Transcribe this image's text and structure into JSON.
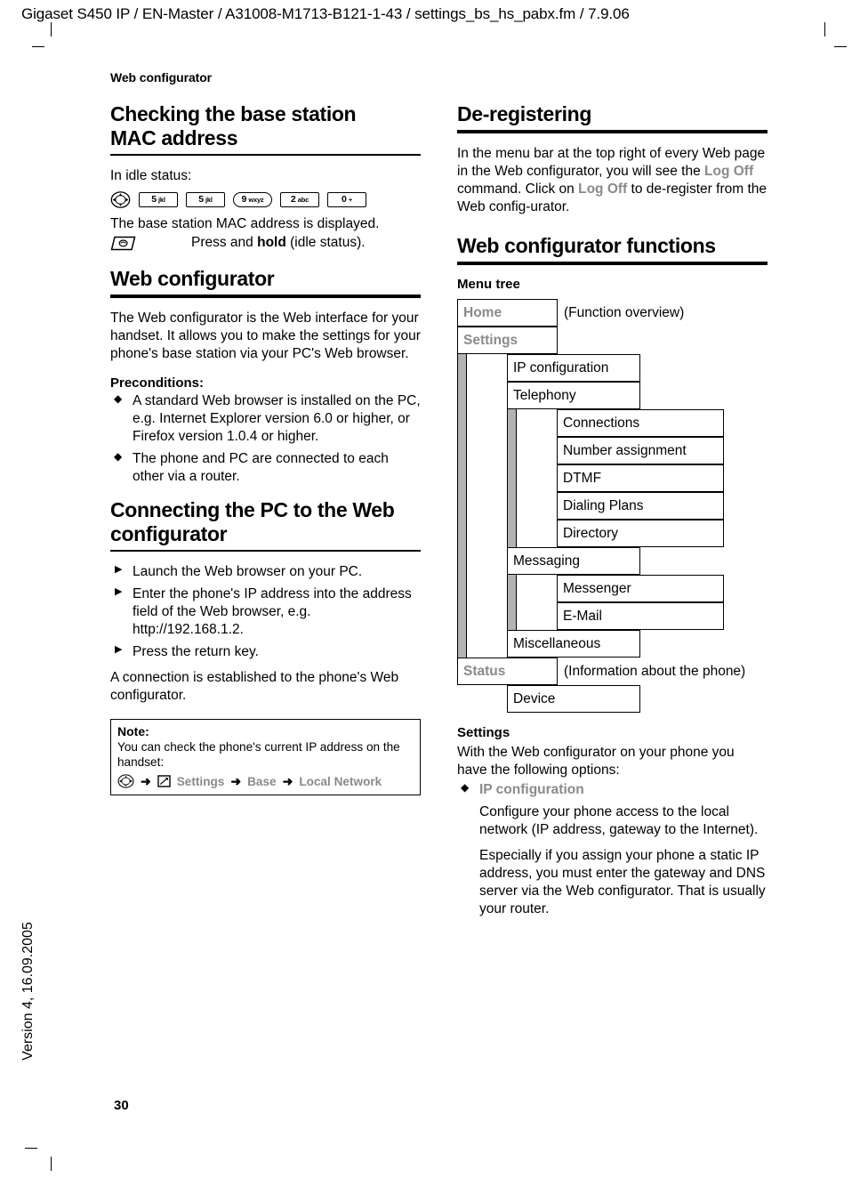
{
  "doc": {
    "header_line": "Gigaset S450 IP / EN-Master / A31008-M1713-B121-1-43 / settings_bs_hs_pabx.fm / 7.9.06",
    "running_head": "Web configurator",
    "page_number": "30",
    "version_note": "Version 4, 16.09.2005"
  },
  "left": {
    "sec1": {
      "title_line1": "Checking the base station",
      "title_line2": "MAC address",
      "intro": "In idle status:",
      "keys": [
        {
          "icon": "control-key-icon",
          "label": "",
          "sub": "",
          "round": false
        },
        {
          "icon": "digit-key",
          "label": "5",
          "sub": "jkl",
          "round": false
        },
        {
          "icon": "digit-key",
          "label": "5",
          "sub": "jkl",
          "round": false
        },
        {
          "icon": "digit-key",
          "label": "9",
          "sub": "wxyz",
          "round": true
        },
        {
          "icon": "digit-key",
          "label": "2",
          "sub": "abc",
          "round": false
        },
        {
          "icon": "digit-key",
          "label": "0",
          "sub": "+",
          "round": false
        }
      ],
      "result_text": "The base station MAC address is displayed.",
      "press_prefix": "Press and ",
      "press_bold": "hold",
      "press_suffix": " (idle status)."
    },
    "sec2": {
      "title": "Web configurator",
      "para1": "The Web configurator is the Web interface for your handset. It allows you to make the settings for your phone's base station via your PC's Web browser.",
      "preconditions_title": "Preconditions:",
      "preconditions": [
        "A standard Web browser is installed on the PC, e.g. Internet Explorer version 6.0 or higher, or Firefox version 1.0.4 or higher.",
        "The phone and PC are connected to each other via a router."
      ]
    },
    "sec3": {
      "title_line1": "Connecting the PC to the Web",
      "title_line2": "configurator",
      "steps": [
        "Launch the Web browser on your PC.",
        "Enter the phone's IP address into the address field of the Web browser, e.g. http://192.168.1.2.",
        "Press the return key."
      ],
      "closing": "A connection is established to the phone's Web configurator."
    },
    "note": {
      "title": "Note:",
      "text": "You can check the phone's current IP address on the handset:",
      "path": [
        {
          "type": "icon",
          "name": "control-key-icon",
          "label": ""
        },
        {
          "type": "arrow",
          "name": "right-arrow-icon",
          "label": "➜"
        },
        {
          "type": "icon",
          "name": "settings-tool-icon",
          "label": ""
        },
        {
          "type": "text",
          "name": "path-settings",
          "label": "Settings"
        },
        {
          "type": "arrow",
          "name": "right-arrow-icon",
          "label": "➜"
        },
        {
          "type": "text",
          "name": "path-base",
          "label": "Base"
        },
        {
          "type": "arrow",
          "name": "right-arrow-icon",
          "label": "➜"
        },
        {
          "type": "text",
          "name": "path-local-network",
          "label": "Local Network"
        }
      ]
    }
  },
  "right": {
    "sec1": {
      "title": "De-registering",
      "para_part1": "In the menu bar at the top right of every Web page in the Web configurator, you will see the ",
      "logoff_1": "Log Off",
      "para_part2": " command. Click on ",
      "logoff_2": "Log Off",
      "para_part3": " to de-register from the Web config-urator."
    },
    "sec2": {
      "title": "Web configurator functions",
      "menu_tree_title": "Menu tree"
    },
    "menu_tree": {
      "annotations": {
        "home": "(Function overview)",
        "status": "(Information about the phone)"
      },
      "rows": [
        {
          "level": 1,
          "label": "Home",
          "header": true,
          "bars": [],
          "annot": "(Function overview)"
        },
        {
          "level": 1,
          "label": "Settings",
          "header": true,
          "bars": [],
          "annot": ""
        },
        {
          "level": 2,
          "label": "IP configuration",
          "header": false,
          "bars": [
            "g1"
          ],
          "annot": ""
        },
        {
          "level": 2,
          "label": "Telephony",
          "header": false,
          "bars": [
            "g1"
          ],
          "annot": ""
        },
        {
          "level": 3,
          "label": "Connections",
          "header": false,
          "bars": [
            "g1",
            "g2"
          ],
          "annot": ""
        },
        {
          "level": 3,
          "label": "Number assignment",
          "header": false,
          "bars": [
            "g1",
            "g2"
          ],
          "annot": ""
        },
        {
          "level": 3,
          "label": "DTMF",
          "header": false,
          "bars": [
            "g1",
            "g2"
          ],
          "annot": ""
        },
        {
          "level": 3,
          "label": "Dialing Plans",
          "header": false,
          "bars": [
            "g1",
            "g2"
          ],
          "annot": ""
        },
        {
          "level": 3,
          "label": "Directory",
          "header": false,
          "bars": [
            "g1",
            "g2"
          ],
          "annot": ""
        },
        {
          "level": 2,
          "label": "Messaging",
          "header": false,
          "bars": [
            "g1"
          ],
          "annot": ""
        },
        {
          "level": 3,
          "label": "Messenger",
          "header": false,
          "bars": [
            "g1",
            "g2"
          ],
          "annot": ""
        },
        {
          "level": 3,
          "label": "E-Mail",
          "header": false,
          "bars": [
            "g1",
            "g2"
          ],
          "annot": ""
        },
        {
          "level": 2,
          "label": "Miscellaneous",
          "header": false,
          "bars": [
            "g1"
          ],
          "annot": ""
        },
        {
          "level": 1,
          "label": "Status",
          "header": true,
          "bars": [],
          "annot": "(Information about the phone)"
        },
        {
          "level": 2,
          "label": "Device",
          "header": false,
          "bars": [],
          "annot": ""
        }
      ]
    },
    "sec3": {
      "title": "Settings",
      "para1": "With the Web configurator on your phone you have the following options:",
      "bullet_label": "IP configuration",
      "sub_para1": "Configure your phone access to the local network (IP address, gateway to the Internet).",
      "sub_para2": "Especially if you assign your phone a static IP address, you must enter the gateway and DNS server via the Web configurator. That is usually your router."
    }
  },
  "colors": {
    "gray_text": "#8a8a8a",
    "gray_bar": "#b3b3b3",
    "ink": "#000000",
    "paper": "#ffffff"
  }
}
